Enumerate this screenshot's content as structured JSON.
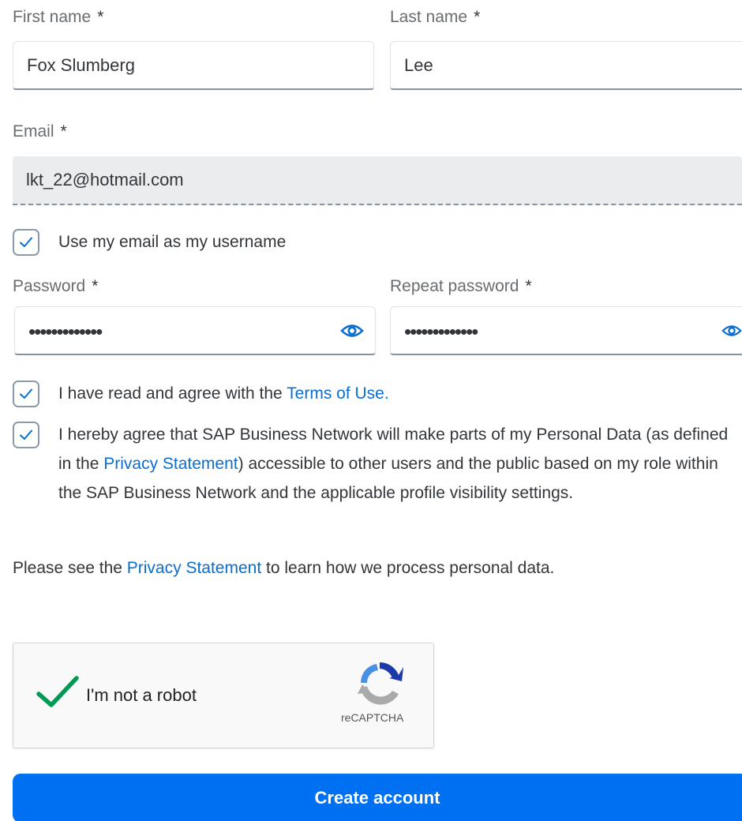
{
  "form": {
    "required_marker": "*",
    "first_name": {
      "label": "First name",
      "value": "Fox Slumberg"
    },
    "last_name": {
      "label": "Last name",
      "value": "Lee"
    },
    "email": {
      "label": "Email",
      "value": "lkt_22@hotmail.com"
    },
    "username_checkbox": {
      "label": "Use my email as my username",
      "checked": true
    },
    "password": {
      "label": "Password",
      "masked_value": "•••••••••••••"
    },
    "repeat_password": {
      "label": "Repeat password",
      "masked_value": "•••••••••••••"
    },
    "terms": {
      "checked": true,
      "text_before": "I have read and agree with the ",
      "link": "Terms of Use",
      "text_after": "."
    },
    "consent": {
      "checked": true,
      "text_before": "I hereby agree that SAP Business Network will make parts of my Personal Data (as defined in the ",
      "link": "Privacy Statement",
      "text_after": ") accessible to other users and the public based on my role within the SAP Business Network and the applicable profile visibility settings."
    },
    "privacy_note": {
      "text_before": "Please see the ",
      "link": "Privacy Statement",
      "text_after": " to learn how we process personal data."
    }
  },
  "recaptcha": {
    "label": "I'm not a robot",
    "brand": "reCAPTCHA",
    "checked": true
  },
  "submit": {
    "label": "Create account"
  },
  "icons": {
    "checkmark": "checkmark-icon",
    "show_password": "eye-icon",
    "recaptcha_logo": "recaptcha-logo-icon"
  },
  "colors": {
    "accent": "#0070f2",
    "link": "#0a6ed1",
    "checkbox_tick": "#0a6ed1",
    "recaptcha_tick": "#009a55"
  }
}
